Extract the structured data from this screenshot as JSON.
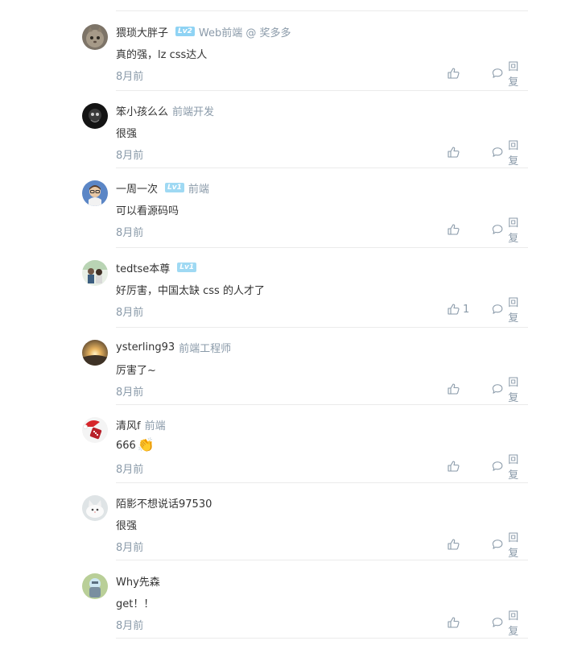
{
  "reply_label": "回复",
  "colors": {
    "meta_gray": "#8a9aa9",
    "level_blue": "#8fd3f4",
    "divider": "#ebebeb"
  },
  "comments": [
    {
      "username": "猥琐大胖子",
      "level": "Lv2",
      "title": "Web前端 @ 奖多多",
      "content": "真的强，lz css达人",
      "time": "8月前",
      "likes": "",
      "avatar": "cat-avatar"
    },
    {
      "username": "笨小孩么么",
      "level": "",
      "title": "前端开发",
      "content": "很强",
      "time": "8月前",
      "likes": "",
      "avatar": "dark-avatar"
    },
    {
      "username": "一周一次",
      "level": "Lv1",
      "title": "前端",
      "content": "可以看源码吗",
      "time": "8月前",
      "likes": "",
      "avatar": "glasses-avatar"
    },
    {
      "username": "tedtse本尊",
      "level": "Lv1",
      "title": "",
      "content": "好厉害，中国太缺 css 的人才了",
      "time": "8月前",
      "likes": "1",
      "avatar": "people-avatar"
    },
    {
      "username": "ysterling93",
      "level": "",
      "title": "前端工程师",
      "content": "厉害了~",
      "time": "8月前",
      "likes": "",
      "avatar": "sunset-avatar"
    },
    {
      "username": "清风f",
      "level": "",
      "title": "前端",
      "content": "666",
      "content_emoji": "👏",
      "time": "8月前",
      "likes": "",
      "avatar": "dice-avatar"
    },
    {
      "username": "陌影不想说话97530",
      "level": "",
      "title": "",
      "content": "很强",
      "time": "8月前",
      "likes": "",
      "avatar": "white-cat-avatar"
    },
    {
      "username": "Why先森",
      "level": "",
      "title": "",
      "content": "get！！",
      "time": "8月前",
      "likes": "",
      "avatar": "cartoon-avatar"
    }
  ]
}
